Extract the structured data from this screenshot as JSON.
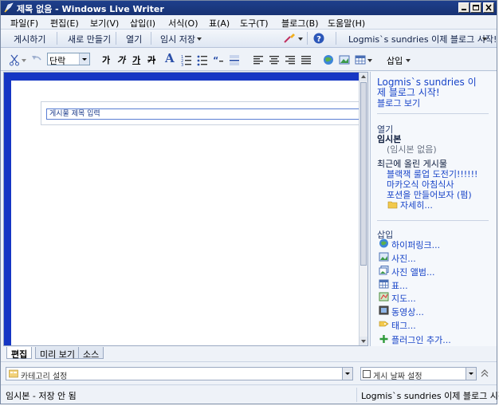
{
  "window": {
    "title": "제목 없음 - Windows Live Writer"
  },
  "menu": [
    "파일(F)",
    "편집(E)",
    "보기(V)",
    "삽입(I)",
    "서식(O)",
    "표(A)",
    "도구(T)",
    "블로그(B)",
    "도움말(H)"
  ],
  "command_bar": {
    "publish": "게시하기",
    "new": "새로 만들기",
    "open": "열기",
    "save_draft": "임시 저장",
    "blog_name": "Logmis`s sundries  이제 블로그 시작!"
  },
  "format_toolbar": {
    "style_select": "단락",
    "font_buttons": [
      "가",
      "가",
      "가",
      "가"
    ],
    "big_a": "A",
    "insert_label": "삽입"
  },
  "editor": {
    "title_placeholder": "게시물 제목 입력"
  },
  "sidebar": {
    "blog_title": "Logmis`s sundries  이",
    "blog_title_2": "제 블로그 시작!",
    "view_blog": "블로그 보기",
    "open_header": "열기",
    "drafts_label": "임시본",
    "no_drafts": "(임시본 없음)",
    "recent_header": "최근에 올린 게시물",
    "recent_posts": [
      "블랙잭 룰업 도전기!!!!!!",
      "마카오식 아침식사",
      "포션을 만들어보자 (펌)"
    ],
    "more": "자세히...",
    "insert_header": "삽입",
    "insert_items": [
      "하이퍼링크...",
      "사진...",
      "사진 앨범...",
      "표...",
      "지도...",
      "동영상...",
      "태그..."
    ],
    "add_plugin": "플러그인 추가..."
  },
  "tabs": [
    "편집",
    "미리 보기",
    "소스"
  ],
  "category": {
    "placeholder": "카테고리 설정"
  },
  "date": {
    "label": "게시 날짜 설정"
  },
  "status": {
    "left": "임시본 - 저장 안 됨",
    "right": "Logmis`s sundries  이제 블로그 시작!"
  },
  "colors": {
    "titlebar": "#1e3f8c",
    "link": "#1844c8",
    "editor_band": "#1536c4"
  }
}
